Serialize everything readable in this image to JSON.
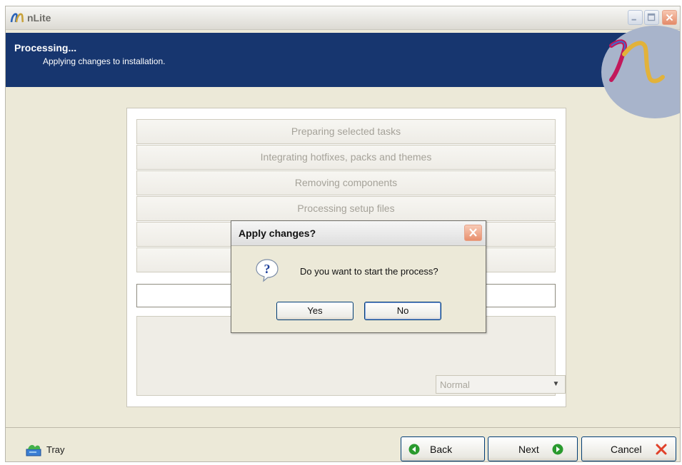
{
  "window": {
    "title": "nLite",
    "controls": [
      "minimize-icon",
      "maximize-icon",
      "close-icon"
    ]
  },
  "banner": {
    "title": "Processing...",
    "subtitle": "Applying changes to installation."
  },
  "tasks": [
    {
      "label": "Preparing selected tasks"
    },
    {
      "label": "Integrating hotfixes, packs and themes"
    },
    {
      "label": "Removing components"
    },
    {
      "label": "Processing setup files"
    },
    {
      "label": ""
    },
    {
      "label": ""
    }
  ],
  "priority": {
    "value": "Normal"
  },
  "footer": {
    "tray_label": "Tray",
    "back_label": "Back",
    "next_label": "Next",
    "cancel_label": "Cancel"
  },
  "dialog": {
    "title": "Apply changes?",
    "message": "Do you want to start the process?",
    "yes_label": "Yes",
    "no_label": "No",
    "icon": "question-icon"
  },
  "colors": {
    "banner": "#17366f",
    "accent_green": "#2a9a2e",
    "close_red": "#e0412a"
  }
}
